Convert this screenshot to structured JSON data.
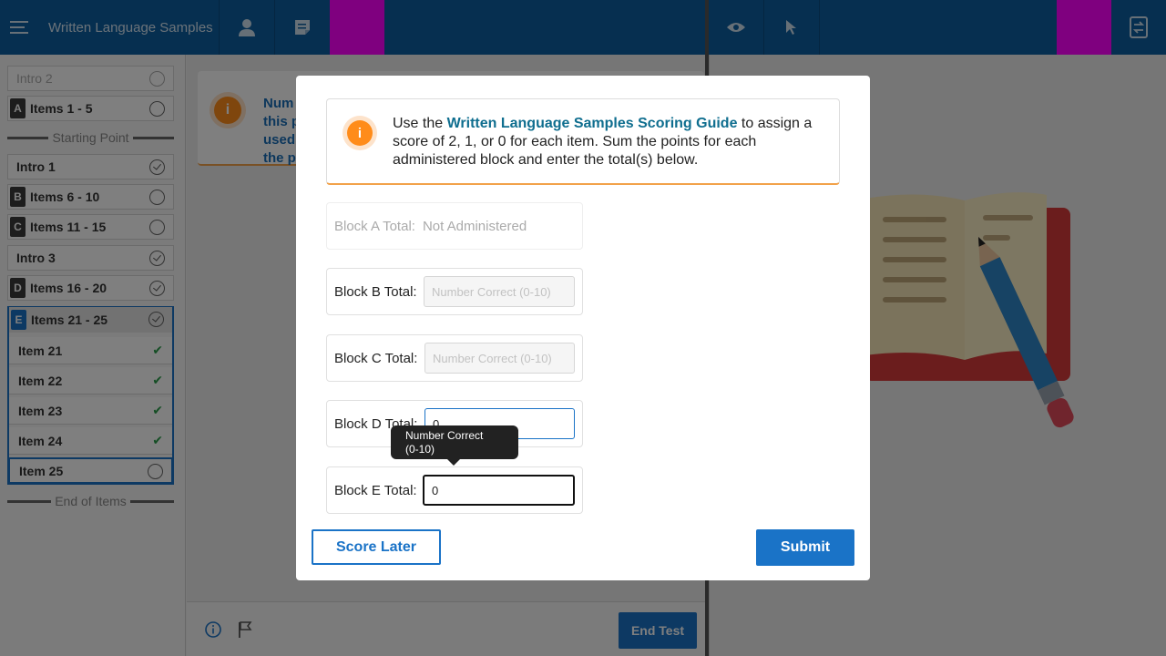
{
  "header": {
    "menu_icon": "hamburger-icon",
    "app_title": "Written Language Samples",
    "person_icon": "person-icon",
    "notes_icon": "notes-icon",
    "eye_icon": "eye-icon",
    "pointer_icon": "pointer-icon",
    "swap_icon": "screen-swap-icon"
  },
  "sidebar": {
    "items": [
      {
        "label": "Intro 2",
        "letter": "",
        "status": "empty"
      },
      {
        "label": "Items 1 - 5",
        "letter": "A",
        "status": "empty"
      },
      {
        "label": "Intro 1",
        "letter": "",
        "status": "check"
      },
      {
        "label": "Items 6 - 10",
        "letter": "B",
        "status": "empty"
      },
      {
        "label": "Items 11 - 15",
        "letter": "C",
        "status": "empty"
      },
      {
        "label": "Intro 3",
        "letter": "",
        "status": "check"
      },
      {
        "label": "Items 16 - 20",
        "letter": "D",
        "status": "check"
      },
      {
        "label": "Items 21 - 25",
        "letter": "E",
        "status": "check"
      }
    ],
    "starting_point": "Starting Point",
    "end_of_items": "End of Items",
    "subitems": [
      {
        "label": "Item 21",
        "status": "done"
      },
      {
        "label": "Item 22",
        "status": "done"
      },
      {
        "label": "Item 23",
        "status": "done"
      },
      {
        "label": "Item 24",
        "status": "done"
      },
      {
        "label": "Item 25",
        "status": "check"
      }
    ]
  },
  "middle": {
    "info_text": "Num\nthis p\nused\nthe p",
    "end_test_label": "End Test"
  },
  "modal": {
    "intro_prefix": "Use the ",
    "intro_link": "Written Language Samples Scoring Guide",
    "intro_suffix": " to assign a score of 2, 1, or 0 for each item. Sum the points for each administered block and enter the total(s) below.",
    "blocks": [
      {
        "label": "Block A Total:",
        "value": "Not Administered",
        "placeholder": ""
      },
      {
        "label": "Block B Total:",
        "value": "",
        "placeholder": "Number Correct (0-10)"
      },
      {
        "label": "Block C Total:",
        "value": "",
        "placeholder": "Number Correct (0-10)"
      },
      {
        "label": "Block D Total:",
        "value": "0",
        "placeholder": ""
      },
      {
        "label": "Block E Total:",
        "value": "0",
        "placeholder": ""
      }
    ],
    "tooltip": "Number Correct\n(0-10)",
    "score_later_label": "Score Later",
    "submit_label": "Submit"
  },
  "colors": {
    "header_blue": "#0d5fa0",
    "accent_blue": "#1a73c7",
    "info_orange": "#ff8c1a",
    "link_teal": "#0f6e8f"
  }
}
